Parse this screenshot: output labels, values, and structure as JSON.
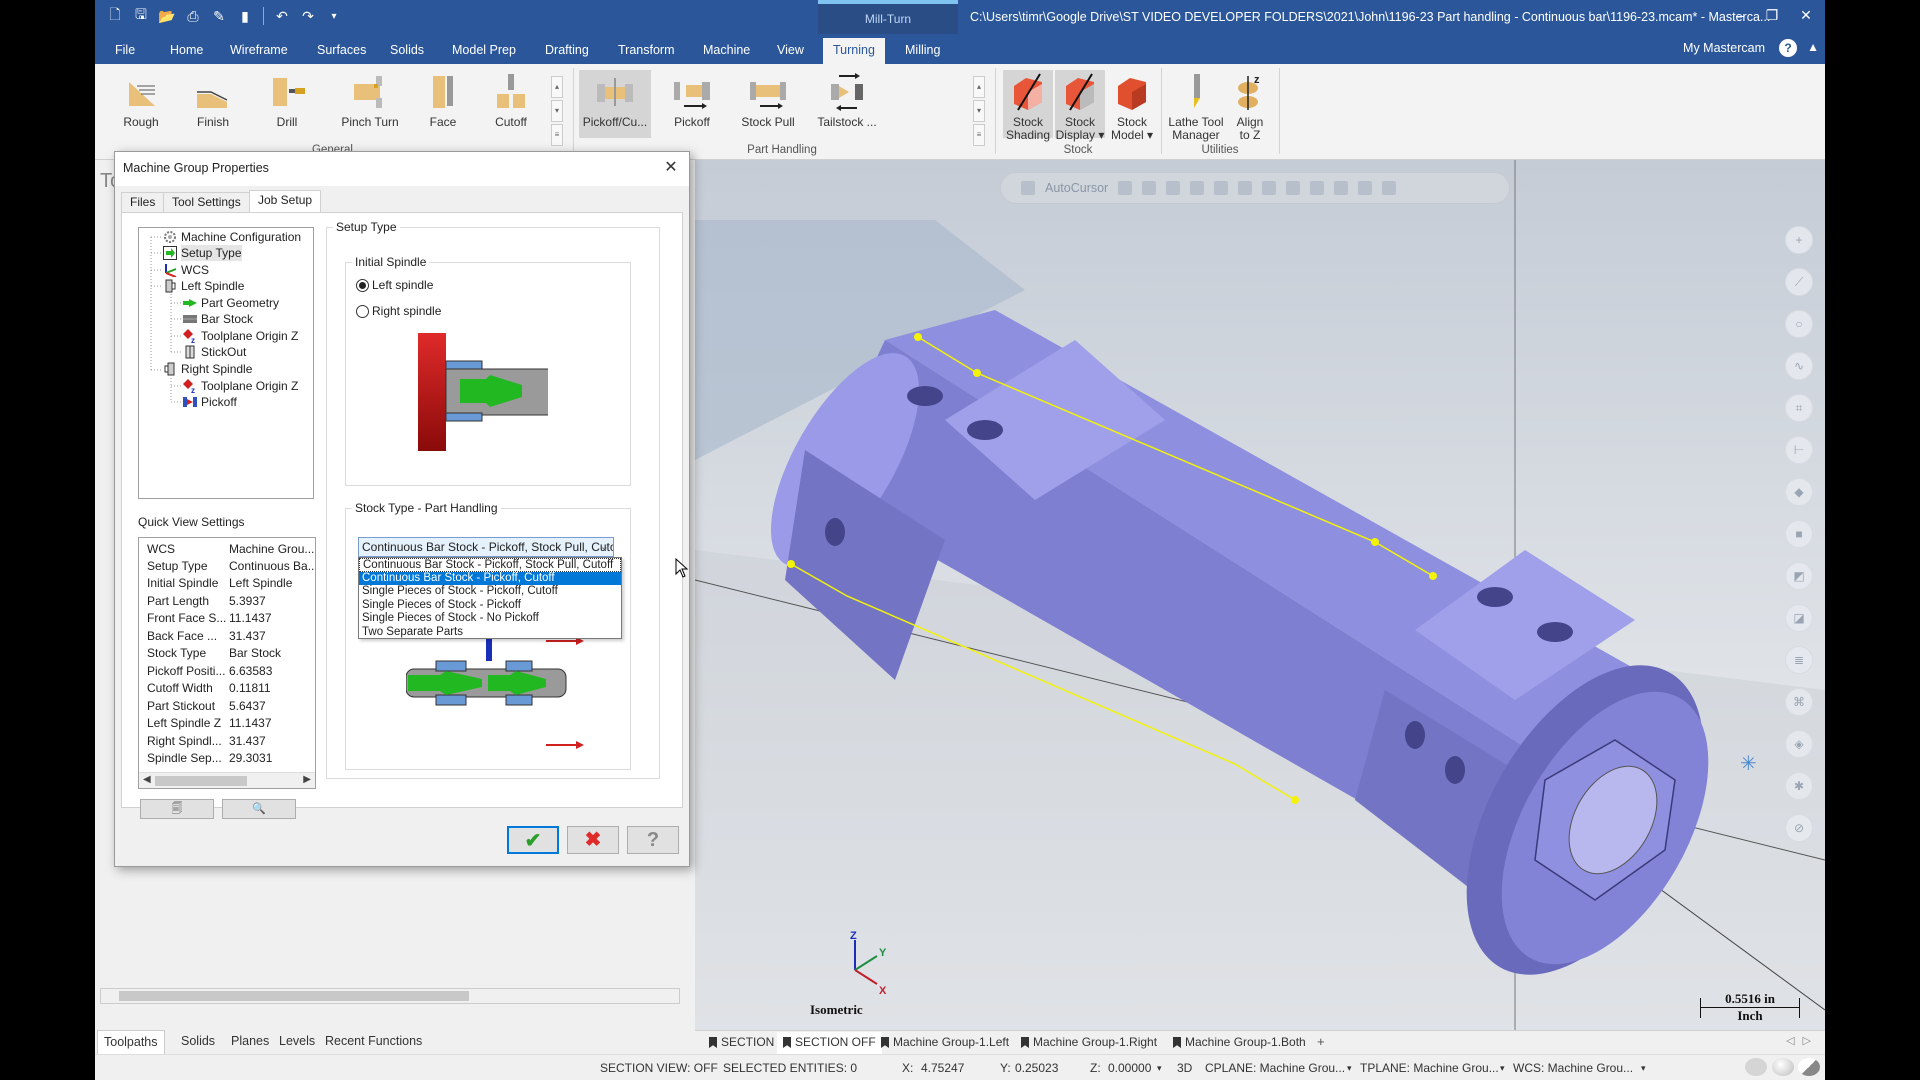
{
  "titlebar": {
    "context_tab": "Mill-Turn",
    "document_title": "C:\\Users\\timr\\Google Drive\\ST VIDEO DEVELOPER FOLDERS\\2021\\John\\1196-23 Part handling - Continuous bar\\1196-23.mcam* - Masterca...",
    "quick_access": [
      "new-file",
      "save",
      "open",
      "print",
      "save-as",
      "merge",
      "undo",
      "redo",
      "customize"
    ],
    "window_controls": {
      "minimize": "–",
      "restore": "❐",
      "close": "✕"
    }
  },
  "ribbon_tabs": [
    "File",
    "Home",
    "Wireframe",
    "Surfaces",
    "Solids",
    "Model Prep",
    "Drafting",
    "Transform",
    "Machine",
    "View",
    "Turning",
    "Milling"
  ],
  "active_ribbon_tab": "Turning",
  "ribbon_right": {
    "my_mastercam": "My Mastercam",
    "help": "?",
    "collapse": "▲"
  },
  "ribbon": {
    "general": {
      "label": "General",
      "buttons": [
        "Rough",
        "Finish",
        "Drill",
        "Pinch Turn",
        "Face",
        "Cutoff"
      ]
    },
    "part_handling": {
      "label": "Part Handling",
      "buttons": [
        "Pickoff/Cu...",
        "Pickoff",
        "Stock Pull",
        "Tailstock ..."
      ],
      "selected": "Pickoff/Cu..."
    },
    "stock": {
      "label": "Stock",
      "buttons": [
        {
          "l1": "Stock",
          "l2": "Shading"
        },
        {
          "l1": "Stock",
          "l2": "Display ▾"
        },
        {
          "l1": "Stock",
          "l2": "Model ▾"
        }
      ]
    },
    "utilities": {
      "label": "Utilities",
      "buttons": [
        {
          "l1": "Lathe Tool",
          "l2": "Manager"
        },
        {
          "l1": "Align",
          "l2": "to Z"
        }
      ]
    }
  },
  "left_panel": {
    "title": "To",
    "tabs": [
      "Toolpaths",
      "Solids",
      "Planes",
      "Levels",
      "Recent Functions"
    ],
    "active_tab": "Toolpaths"
  },
  "dialog": {
    "title": "Machine Group Properties",
    "tabs": [
      "Files",
      "Tool Settings",
      "Job Setup"
    ],
    "active_tab": "Job Setup",
    "tree": [
      {
        "label": "Machine Configuration",
        "level": 0,
        "icon": "gear-icon"
      },
      {
        "label": "Setup Type",
        "level": 0,
        "icon": "setup-type-icon",
        "selected": true
      },
      {
        "label": "WCS",
        "level": 0,
        "icon": "wcs-axes-icon"
      },
      {
        "label": "Left Spindle",
        "level": 0,
        "icon": "spindle-icon"
      },
      {
        "label": "Part Geometry",
        "level": 1,
        "icon": "part-geometry-icon"
      },
      {
        "label": "Bar Stock",
        "level": 1,
        "icon": "bar-stock-icon"
      },
      {
        "label": "Toolplane Origin Z",
        "level": 1,
        "icon": "toolplane-origin-icon"
      },
      {
        "label": "StickOut",
        "level": 1,
        "icon": "stickout-icon"
      },
      {
        "label": "Right Spindle",
        "level": 0,
        "icon": "spindle-icon"
      },
      {
        "label": "Toolplane Origin Z",
        "level": 1,
        "icon": "toolplane-origin-icon"
      },
      {
        "label": "Pickoff",
        "level": 1,
        "icon": "pickoff-icon"
      }
    ],
    "quick_view_label": "Quick View Settings",
    "quick_view": [
      {
        "key": "WCS",
        "value": "Machine Grou..."
      },
      {
        "key": "Setup Type",
        "value": "Continuous Ba..."
      },
      {
        "key": "Initial Spindle",
        "value": "Left Spindle"
      },
      {
        "key": "Part Length",
        "value": "5.3937"
      },
      {
        "key": "Front Face S...",
        "value": "11.1437"
      },
      {
        "key": "Back Face ...",
        "value": "31.437"
      },
      {
        "key": "Stock Type",
        "value": "Bar Stock"
      },
      {
        "key": "Pickoff Positi...",
        "value": "6.63583"
      },
      {
        "key": "Cutoff Width",
        "value": "0.11811"
      },
      {
        "key": "Part Stickout",
        "value": "5.6437"
      },
      {
        "key": "Left Spindle Z",
        "value": "11.1437"
      },
      {
        "key": "Right Spindl...",
        "value": "31.437"
      },
      {
        "key": "Spindle Sep...",
        "value": "29.3031"
      }
    ],
    "setup_type_label": "Setup Type",
    "initial_spindle_label": "Initial Spindle",
    "radios": [
      {
        "label": "Left spindle",
        "checked": true
      },
      {
        "label": "Right spindle",
        "checked": false
      }
    ],
    "stock_type_label": "Stock Type - Part Handling",
    "stock_select_value": "Continuous Bar Stock - Pickoff, Stock Pull, Cutc",
    "stock_options": [
      "Continuous Bar Stock - Pickoff, Stock Pull, Cutoff",
      "Continuous Bar Stock - Pickoff, Cutoff",
      "Single Pieces of Stock - Pickoff, Cutoff",
      "Single Pieces of Stock - Pickoff",
      "Single Pieces of Stock - No Pickoff",
      "Two Separate Parts"
    ],
    "highlighted_option_index": 1,
    "buttons": {
      "ok": "✔",
      "cancel": "✖",
      "help": "?"
    }
  },
  "viewport": {
    "autocursor_label": "AutoCursor",
    "view_name": "Isometric",
    "scale_value": "0.5516 in",
    "scale_unit": "Inch",
    "gnomon": {
      "x": "X",
      "y": "Y",
      "z": "Z"
    },
    "colors": {
      "part": "#8f8fe0",
      "part_shadow": "#6e6ebd",
      "select": "#f2f20a"
    }
  },
  "view_tabs": [
    "SECTION",
    "SECTION OFF",
    "Machine Group-1.Left",
    "Machine Group-1.Right",
    "Machine Group-1.Both"
  ],
  "active_view_tab": "SECTION OFF",
  "statusbar": {
    "section_view": "SECTION VIEW: OFF",
    "selected_entities": "SELECTED ENTITIES: 0",
    "x_label": "X:",
    "x_value": "4.75247",
    "y_label": "Y:",
    "y_value": "0.25023",
    "z_label": "Z:",
    "z_value": "0.00000",
    "mode": "3D",
    "cplane": "CPLANE: Machine Grou...",
    "tplane": "TPLANE: Machine Grou...",
    "wcs": "WCS: Machine Grou..."
  }
}
